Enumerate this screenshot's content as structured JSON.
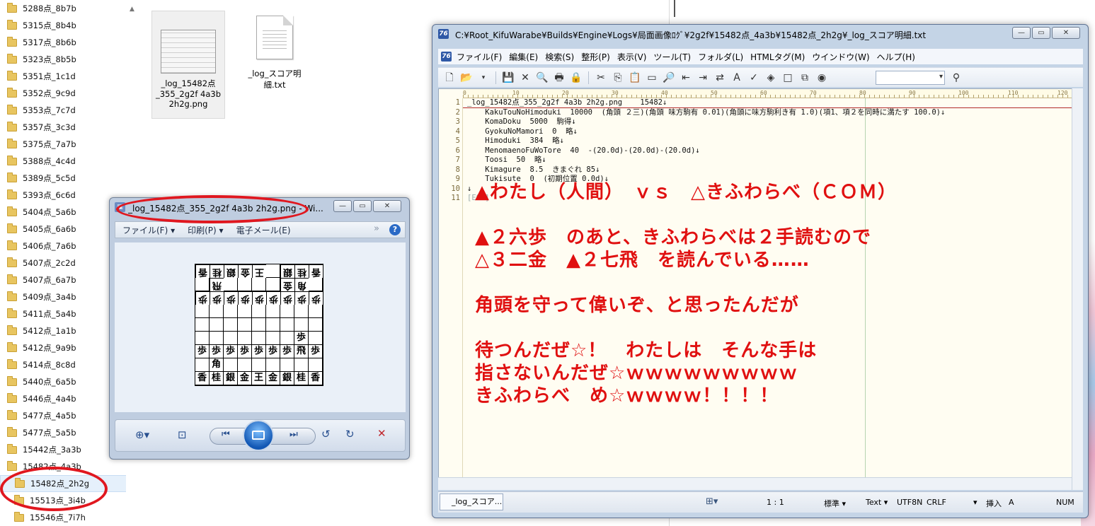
{
  "tree": {
    "items": [
      "5288点_8b7b",
      "5315点_8b4b",
      "5317点_8b6b",
      "5323点_8b5b",
      "5351点_1c1d",
      "5352点_9c9d",
      "5353点_7c7d",
      "5357点_3c3d",
      "5375点_7a7b",
      "5388点_4c4d",
      "5389点_5c5d",
      "5393点_6c6d",
      "5404点_5a6b",
      "5405点_6a6b",
      "5406点_7a6b",
      "5407点_2c2d",
      "5407点_6a7b",
      "5409点_3a4b",
      "5411点_5a4b",
      "5412点_1a1b",
      "5412点_9a9b",
      "5414点_8c8d",
      "5440点_6a5b",
      "5446点_4a4b",
      "5477点_4a5b",
      "5477点_5a5b",
      "15442点_3a3b",
      "15482点_4a3b",
      "15482点_2h2g",
      "15513点_3i4b",
      "15546点_7i7h"
    ],
    "selected": "15482点_2h2g"
  },
  "files": [
    {
      "name_lines": [
        "_log_15482点",
        "_355_2g2f 4a3b",
        "2h2g.png"
      ],
      "icon": "image-thumbnail-icon"
    },
    {
      "name_lines": [
        "_log_スコア明",
        "細.txt"
      ],
      "icon": "text-file-icon"
    }
  ],
  "viewer": {
    "title": "_log_15482点_355_2g2f 4a3b 2h2g.png - Wi...",
    "menu": [
      "ファイル(F) ▾",
      "印刷(P) ▾",
      "電子メール(E)"
    ],
    "help": "?",
    "board": [
      [
        "香",
        "桂",
        "銀",
        "金",
        "王",
        "",
        "銀",
        "桂",
        "香"
      ],
      [
        "",
        "飛",
        "",
        "",
        "",
        "",
        "金",
        "角",
        ""
      ],
      [
        "歩",
        "歩",
        "歩",
        "歩",
        "歩",
        "歩",
        "歩",
        "歩",
        "歩"
      ],
      [
        "",
        "",
        "",
        "",
        "",
        "",
        "",
        "",
        ""
      ],
      [
        "",
        "",
        "",
        "",
        "",
        "",
        "",
        "",
        ""
      ],
      [
        "",
        "",
        "",
        "",
        "",
        "",
        "",
        "歩",
        ""
      ],
      [
        "歩",
        "歩",
        "歩",
        "歩",
        "歩",
        "歩",
        "歩",
        "飛",
        "歩"
      ],
      [
        "",
        "角",
        "",
        "",
        "",
        "",
        "",
        "",
        ""
      ],
      [
        "香",
        "桂",
        "銀",
        "金",
        "王",
        "金",
        "銀",
        "桂",
        "香"
      ]
    ]
  },
  "editor": {
    "title": "C:¥Root_KifuWarabe¥Builds¥Engine¥Logs¥局面画像ﾛｸﾞ¥2g2f¥15482点_4a3b¥15482点_2h2g¥_log_スコア明細.txt",
    "menu": [
      "ファイル(F)",
      "編集(E)",
      "検索(S)",
      "整形(P)",
      "表示(V)",
      "ツール(T)",
      "フォルダ(L)",
      "HTMLタグ(M)",
      "ウインドウ(W)",
      "ヘルプ(H)"
    ],
    "ruler": [
      "0",
      "10",
      "20",
      "30",
      "40",
      "50",
      "60",
      "70",
      "80",
      "90",
      "100",
      "110",
      "120"
    ],
    "line_numbers": [
      "1",
      "2",
      "3",
      "4",
      "5",
      "6",
      "7",
      "8",
      "9",
      "10",
      "11"
    ],
    "lines": [
      "_log_15482点_355_2g2f 4a3b 2h2g.png    15482↓",
      "    KakuTouNoHimoduki  10000  (角頭 ２三)(角頭 味方駒有 0.01)(角頭に味方駒利き有 1.0)(項1、項２を同時に満たす 100.0)↓",
      "    KomaDoku  5000  駒得↓",
      "    GyokuNoMamori  0  略↓",
      "    Himoduki  384  略↓",
      "    MenomaenoFuWoTore  40  -(20.0d)-(20.0d)-(20.0d)↓",
      "    Toosi  50  略↓",
      "    Kimagure  8.5  きまぐれ 85↓",
      "    Tukisute  0  (初期位置 0.0d)↓",
      "↓",
      "[EOF]"
    ],
    "overlay": [
      "▲わたし（人間）　ｖｓ　△きふわらべ（ＣＯＭ）",
      "",
      "▲２六歩　のあと、きふわらべは２手読むので",
      "△３二金　▲２七飛　を読んでいる……",
      "",
      "角頭を守って偉いぞ、と思ったんだが",
      "",
      "待つんだぜ☆！　わたしは　そんな手は",
      "指さないんだぜ☆ｗｗｗｗｗｗｗｗｗ",
      "きふわらべ　め☆ｗｗｗｗ！！！！"
    ],
    "status": {
      "tab": "_log_スコア...",
      "position": "1 : 1",
      "mode": "標準 ▾",
      "type": "Text ▾",
      "encoding": "UTF8N",
      "eol": "CRLF",
      "eol_arrow": "▾",
      "insert": "挿入",
      "ime": "A",
      "numlock": "NUM"
    }
  },
  "colors": {
    "annotation": "#e0171f",
    "overlay_text": "#e01010"
  }
}
